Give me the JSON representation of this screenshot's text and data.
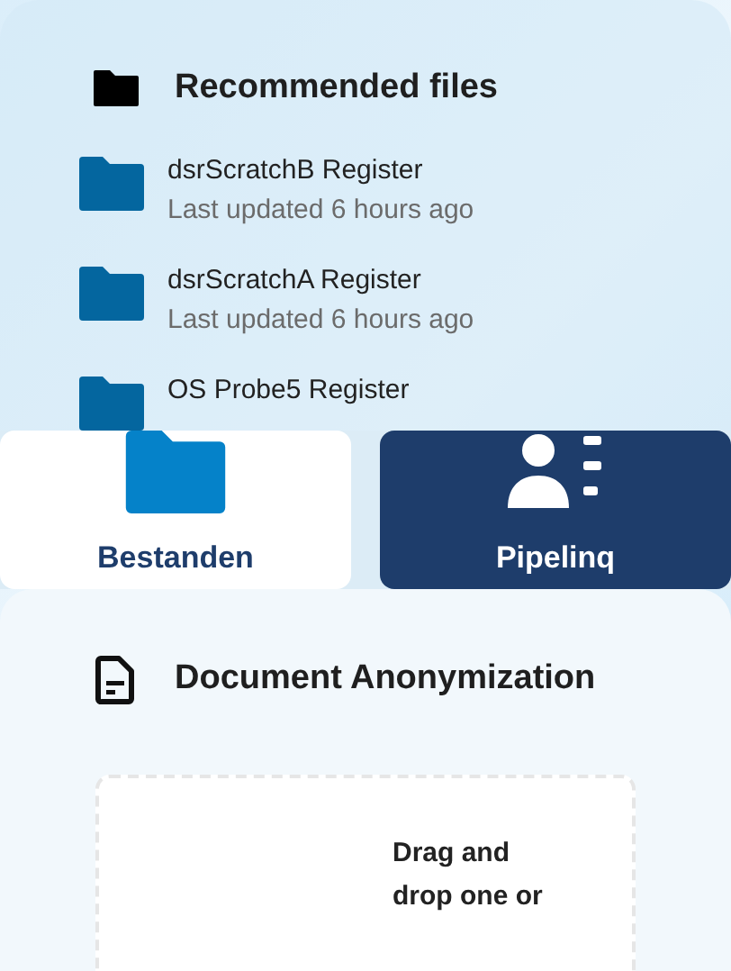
{
  "recommended": {
    "title": "Recommended files",
    "files": [
      {
        "name": "dsrScratchB Register",
        "updated": "Last updated 6 hours ago"
      },
      {
        "name": "dsrScratchA Register",
        "updated": "Last updated 6 hours ago"
      },
      {
        "name": "OS Probe5 Register"
      }
    ]
  },
  "tiles": [
    {
      "kind": "folder",
      "label": "Bestanden",
      "selected": false
    },
    {
      "kind": "person",
      "label": "Pipelinq",
      "selected": true
    }
  ],
  "anonymization": {
    "title": "Document Anonymization",
    "dropzone_text": "Drag and drop one or"
  }
}
